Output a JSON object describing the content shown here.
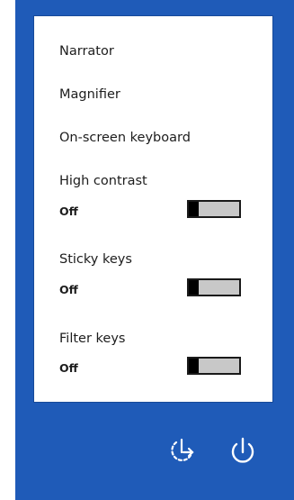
{
  "menu": {
    "items": [
      {
        "label": "Narrator"
      },
      {
        "label": "Magnifier"
      },
      {
        "label": "On-screen keyboard"
      }
    ],
    "toggles": [
      {
        "label": "High contrast",
        "state": "Off",
        "on": false
      },
      {
        "label": "Sticky keys",
        "state": "Off",
        "on": false
      },
      {
        "label": "Filter keys",
        "state": "Off",
        "on": false
      }
    ]
  },
  "footer": {
    "icons": [
      "ease-of-access-icon",
      "power-icon"
    ]
  },
  "colors": {
    "background": "#1f5bb8",
    "panel": "#ffffff",
    "toggle_track": "#c8c8c8",
    "toggle_thumb": "#000000"
  }
}
